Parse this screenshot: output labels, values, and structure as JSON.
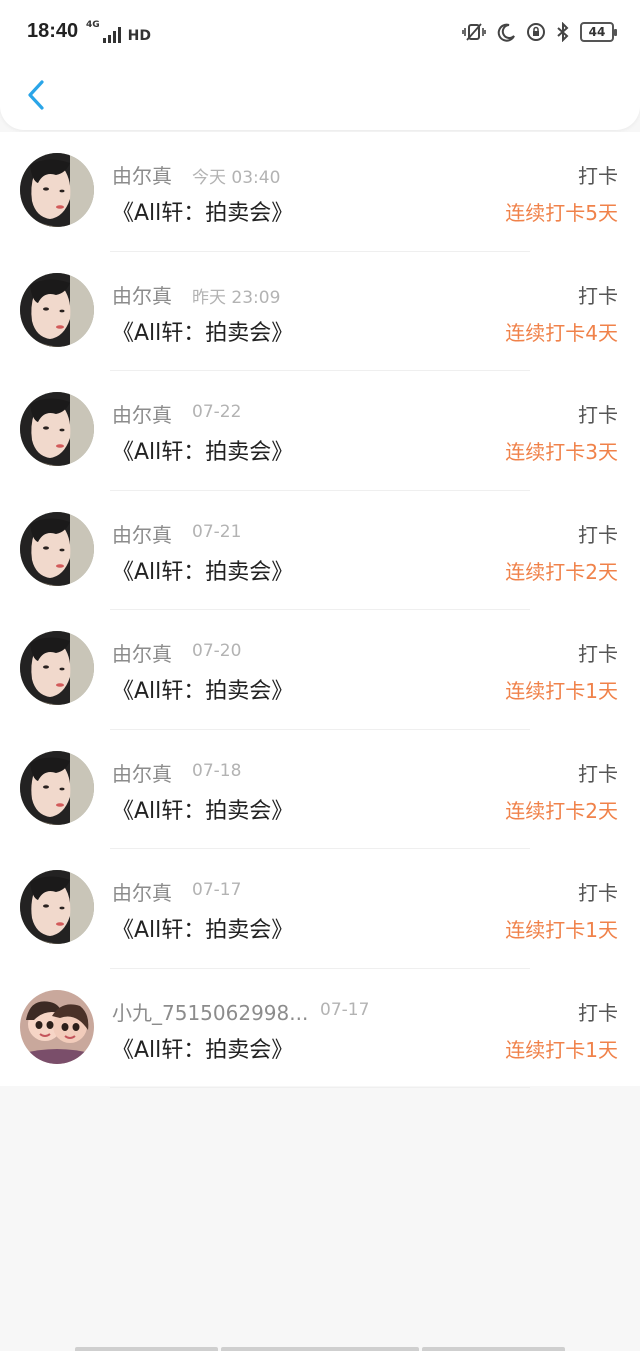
{
  "status_bar": {
    "time": "18:40",
    "network": "4G",
    "hd": "HD",
    "battery": "44",
    "icons": [
      "vibrate-icon",
      "moon-icon",
      "rotation-lock-icon",
      "bluetooth-icon",
      "battery-icon"
    ]
  },
  "nav": {
    "back_icon": "chevron-left-icon",
    "accent_color": "#2aa5e8"
  },
  "colors": {
    "streak": "#f0824a",
    "name": "#8c8c8c",
    "time": "#b3b3b3"
  },
  "records": [
    {
      "name": "由尔真",
      "time": "今天 03:40",
      "title": "《All轩：拍卖会》",
      "action": "打卡",
      "streak": "连续打卡5天",
      "avatar": "avatar-girl"
    },
    {
      "name": "由尔真",
      "time": "昨天 23:09",
      "title": "《All轩：拍卖会》",
      "action": "打卡",
      "streak": "连续打卡4天",
      "avatar": "avatar-girl"
    },
    {
      "name": "由尔真",
      "time": "07-22",
      "title": "《All轩：拍卖会》",
      "action": "打卡",
      "streak": "连续打卡3天",
      "avatar": "avatar-girl"
    },
    {
      "name": "由尔真",
      "time": "07-21",
      "title": "《All轩：拍卖会》",
      "action": "打卡",
      "streak": "连续打卡2天",
      "avatar": "avatar-girl"
    },
    {
      "name": "由尔真",
      "time": "07-20",
      "title": "《All轩：拍卖会》",
      "action": "打卡",
      "streak": "连续打卡1天",
      "avatar": "avatar-girl"
    },
    {
      "name": "由尔真",
      "time": "07-18",
      "title": "《All轩：拍卖会》",
      "action": "打卡",
      "streak": "连续打卡2天",
      "avatar": "avatar-girl"
    },
    {
      "name": "由尔真",
      "time": "07-17",
      "title": "《All轩：拍卖会》",
      "action": "打卡",
      "streak": "连续打卡1天",
      "avatar": "avatar-girl"
    },
    {
      "name": "小九_7515062998...",
      "time": "07-17",
      "title": "《All轩：拍卖会》",
      "action": "打卡",
      "streak": "连续打卡1天",
      "avatar": "avatar-cartoon"
    }
  ]
}
